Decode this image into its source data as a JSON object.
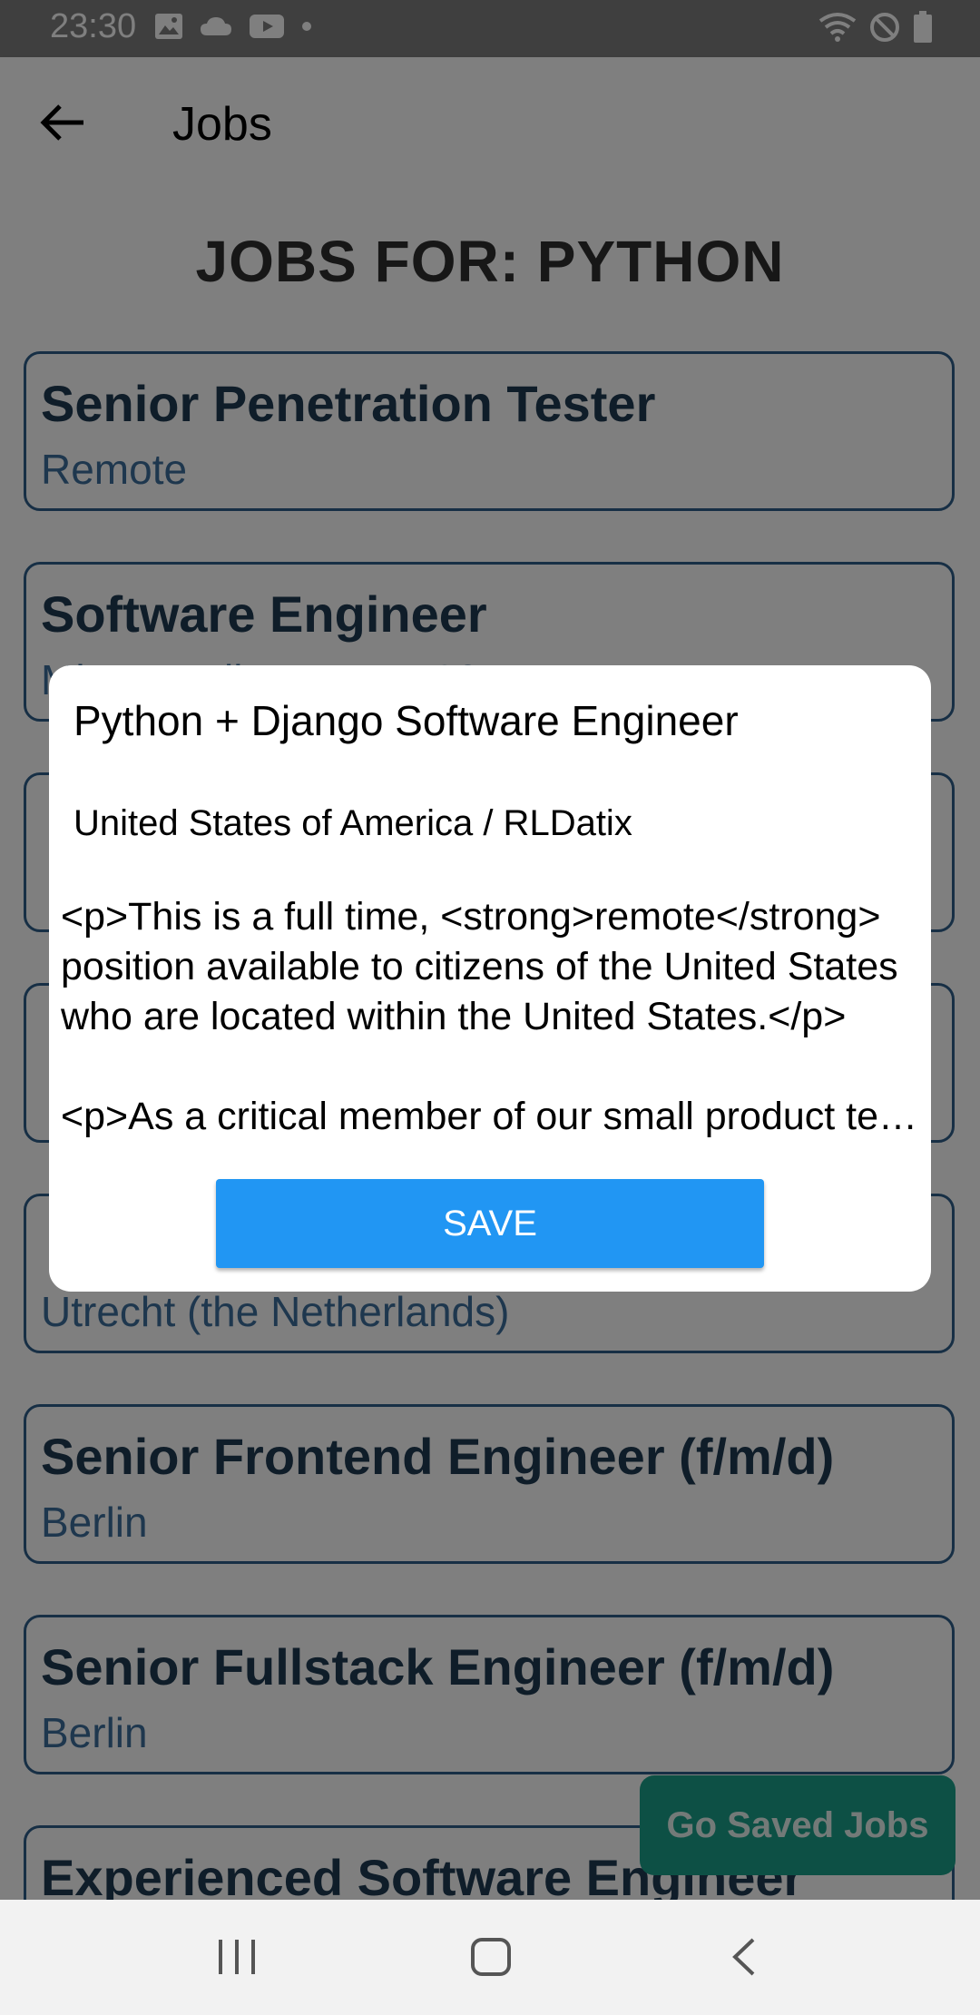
{
  "status_bar": {
    "time": "23:30",
    "left_icons": [
      "image-icon",
      "cloud-icon",
      "youtube-icon",
      "dot-icon"
    ],
    "right_icons": [
      "wifi-icon",
      "do-not-disturb-icon",
      "battery-icon"
    ]
  },
  "app_bar": {
    "back_icon": "arrow-left-icon",
    "title": "Jobs"
  },
  "page": {
    "heading": "JOBS FOR: PYTHON"
  },
  "jobs": [
    {
      "title": "Senior Penetration Tester",
      "location": "Remote"
    },
    {
      "title": "Software Engineer",
      "location": "Minneapolis, MN 55402"
    },
    {
      "title": "",
      "location": ""
    },
    {
      "title": "",
      "location": ""
    },
    {
      "title": "",
      "location": "Utrecht (the Netherlands)"
    },
    {
      "title": "Senior Frontend Engineer (f/m/d)",
      "location": "Berlin"
    },
    {
      "title": "Senior Fullstack Engineer (f/m/d)",
      "location": "Berlin"
    },
    {
      "title": "Experienced Software Engineer",
      "location": ""
    }
  ],
  "saved_jobs_button": "Go Saved Jobs",
  "dialog": {
    "title": "Python + Django Software Engineer",
    "subtitle": "United States of America /  RLDatix",
    "description_line_1": "<p>This is a full time, <strong>remote</strong> position available to citizens of the United States who are located within the United States.</p>",
    "description_line_2": "<p>As a critical member of our small product team",
    "save_label": "SAVE"
  },
  "nav_bar": {
    "icons": [
      "recent-apps-icon",
      "home-icon",
      "back-icon"
    ]
  }
}
